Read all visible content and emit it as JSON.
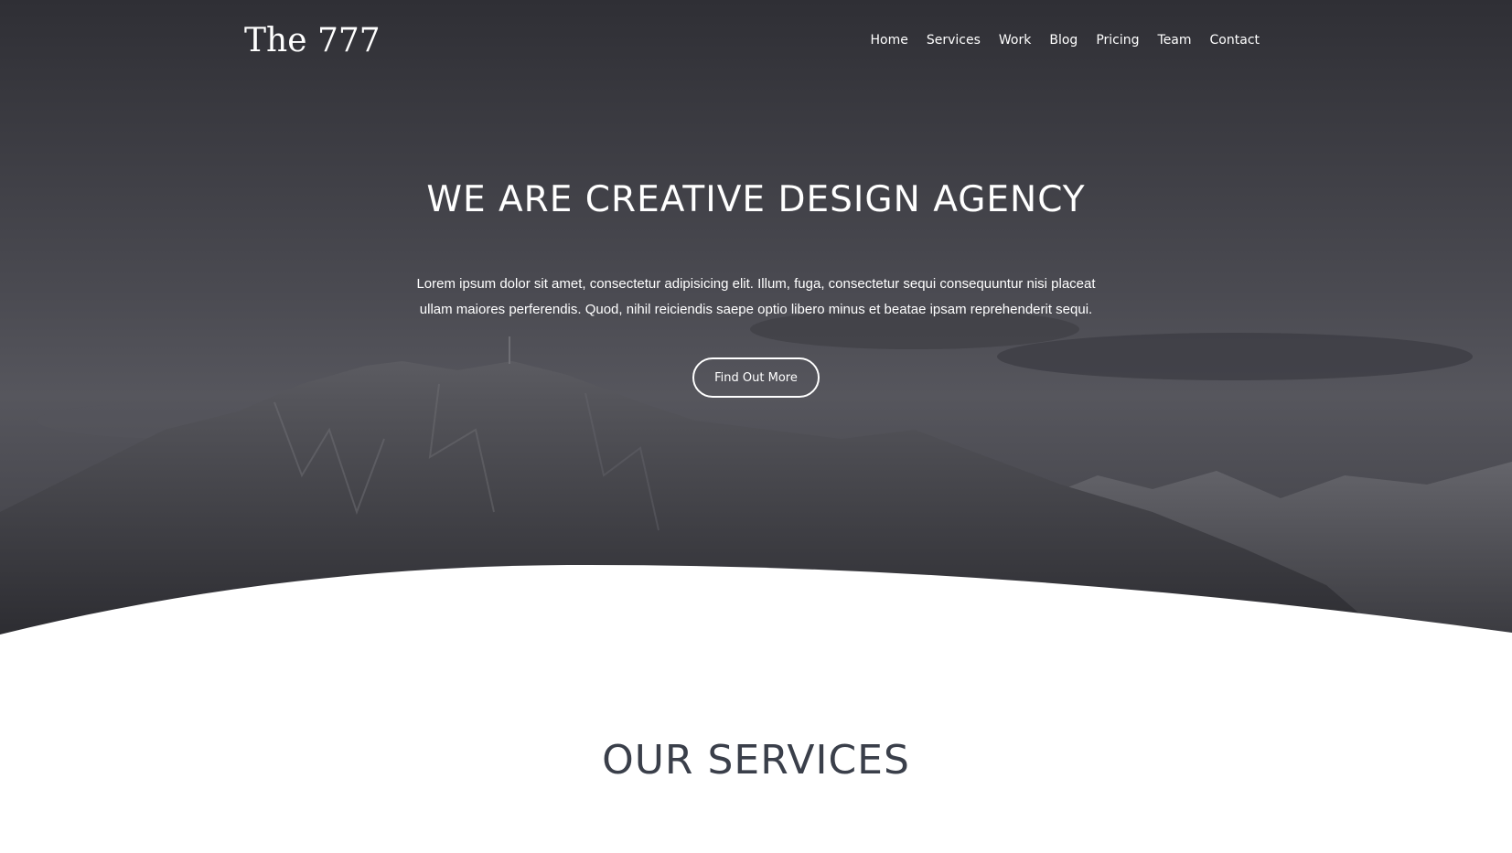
{
  "header": {
    "logo": "The 777",
    "nav": [
      "Home",
      "Services",
      "Work",
      "Blog",
      "Pricing",
      "Team",
      "Contact"
    ]
  },
  "hero": {
    "title": "WE ARE CREATIVE DESIGN AGENCY",
    "text_line1": "Lorem ipsum dolor sit amet, consectetur adipisicing elit. Illum, fuga, consectetur sequi consequuntur nisi placeat",
    "text_line2": "ullam maiores perferendis. Quod, nihil reiciendis saepe optio libero minus et beatae ipsam reprehenderit sequi.",
    "button_label": "Find Out More",
    "background": "mountain landscape photo, dark grayscale overlay"
  },
  "services": {
    "title": "OUR SERVICES"
  },
  "colors": {
    "hero_overlay": "#44444a",
    "text_light": "#ffffff",
    "section_title": "#3a3f4a",
    "page_bg": "#ffffff"
  }
}
